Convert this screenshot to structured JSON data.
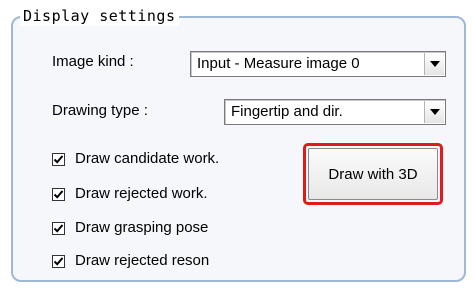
{
  "panel": {
    "title": "Display settings"
  },
  "image_kind": {
    "label": "Image kind :",
    "value": "Input - Measure image 0"
  },
  "drawing_type": {
    "label": "Drawing type :",
    "value": "Fingertip and dir."
  },
  "checkboxes": [
    {
      "label": "Draw candidate work.",
      "checked": true
    },
    {
      "label": "Draw rejected work.",
      "checked": true
    },
    {
      "label": "Draw grasping pose",
      "checked": true
    },
    {
      "label": "Draw rejected reson",
      "checked": true
    }
  ],
  "draw_3d_button": {
    "label": "Draw with 3D",
    "highlight_color": "#e01b1b"
  },
  "icons": {
    "combo_arrow": "chevron-down-icon",
    "check": "checkmark-icon"
  }
}
